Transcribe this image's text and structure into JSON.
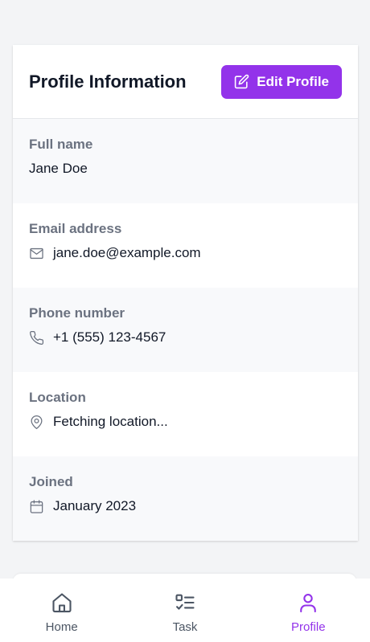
{
  "profile": {
    "title": "Profile Information",
    "edit_label": "Edit Profile",
    "fields": [
      {
        "label": "Full name",
        "value": "Jane Doe",
        "icon": ""
      },
      {
        "label": "Email address",
        "value": "jane.doe@example.com",
        "icon": "mail-icon"
      },
      {
        "label": "Phone number",
        "value": "+1 (555) 123-4567",
        "icon": "phone-icon"
      },
      {
        "label": "Location",
        "value": "Fetching location...",
        "icon": "map-pin-icon"
      },
      {
        "label": "Joined",
        "value": "January 2023",
        "icon": "calendar-icon"
      }
    ]
  },
  "nav": {
    "items": [
      {
        "label": "Home",
        "icon": "home-icon",
        "active": false
      },
      {
        "label": "Task",
        "icon": "task-list-icon",
        "active": false
      },
      {
        "label": "Profile",
        "icon": "user-icon",
        "active": true
      }
    ]
  },
  "colors": {
    "accent": "#9333ea",
    "page_background": "#f3f4f6",
    "label_gray": "#6b7280"
  }
}
